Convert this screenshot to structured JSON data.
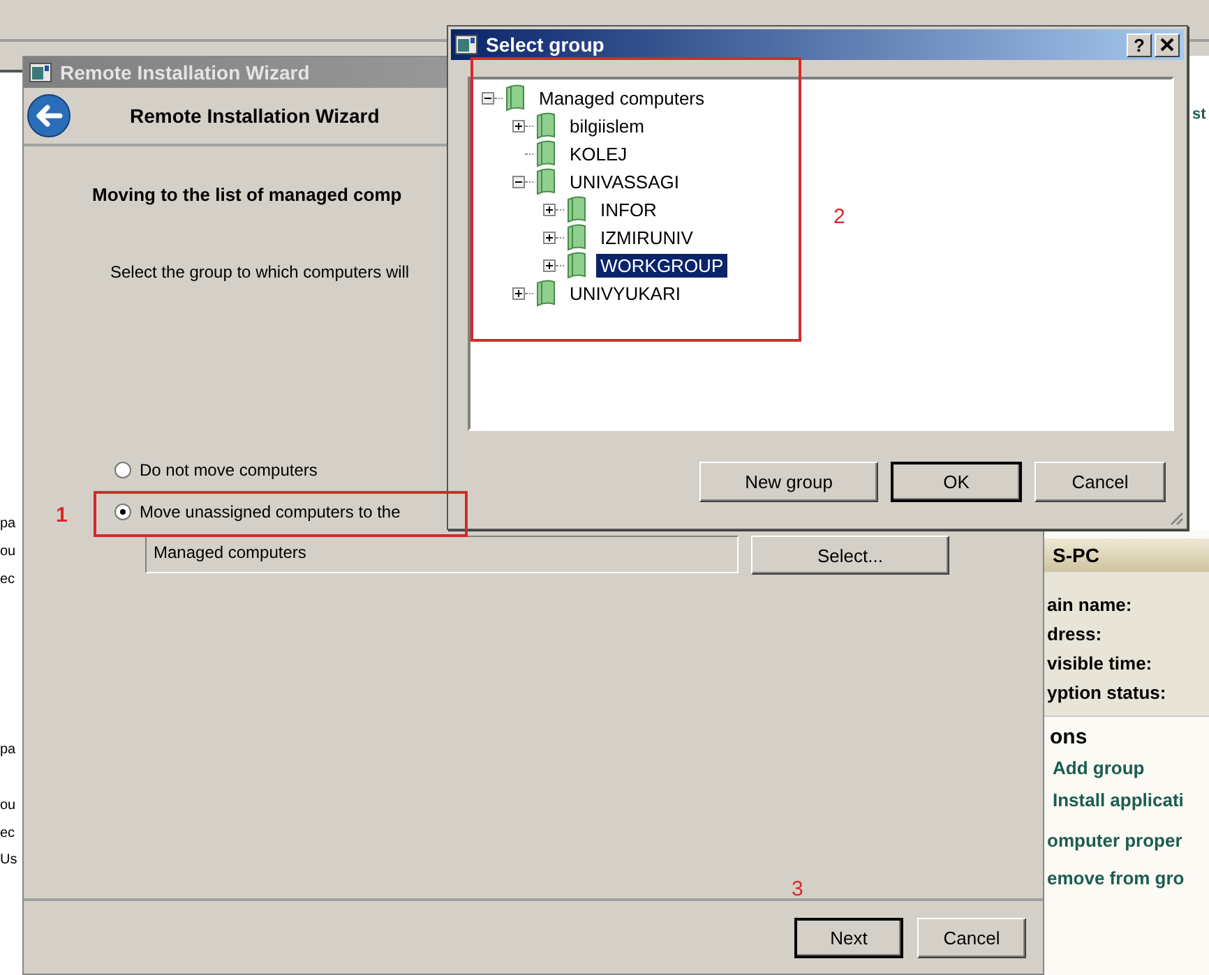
{
  "background": {
    "left_fragments": [
      [
        "pa",
        "ou",
        "ec"
      ],
      [
        "pa"
      ],
      [
        "ou",
        "ec",
        "Us"
      ]
    ],
    "right_fragment": "st",
    "details_panel": {
      "header": "S-PC",
      "fields": [
        "ain name:",
        "dress:",
        "visible time:",
        "yption status:"
      ],
      "section": "ons",
      "links": [
        "Add group",
        "Install applicati",
        "omputer proper",
        "emove from gro"
      ]
    }
  },
  "wizard": {
    "title": "Remote Installation Wizard",
    "header": "Remote Installation Wizard",
    "heading": "Moving to the list of managed comp",
    "description": "Select the group to which computers will",
    "options": [
      {
        "label": "Do not move computers",
        "selected": false
      },
      {
        "label": "Move unassigned computers to the",
        "selected": true
      }
    ],
    "group_field": {
      "value": "Managed computers"
    },
    "select_button": "Select...",
    "buttons": [
      "Next",
      "Cancel"
    ]
  },
  "dialog": {
    "title": "Select group",
    "help_button": "?",
    "tree": [
      {
        "label": "Managed computers",
        "expandable": true,
        "expanded": true,
        "selected": false,
        "children": [
          {
            "label": "bilgiislem",
            "expandable": true,
            "expanded": false,
            "selected": false
          },
          {
            "label": "KOLEJ",
            "expandable": false,
            "selected": false
          },
          {
            "label": "UNIVASSAGI",
            "expandable": true,
            "expanded": true,
            "selected": false,
            "children": [
              {
                "label": "INFOR",
                "expandable": true,
                "expanded": false,
                "selected": false
              },
              {
                "label": "IZMIRUNIV",
                "expandable": true,
                "expanded": false,
                "selected": false
              },
              {
                "label": "WORKGROUP",
                "expandable": true,
                "expanded": false,
                "selected": true
              }
            ]
          },
          {
            "label": "UNIVYUKARI",
            "expandable": true,
            "expanded": false,
            "selected": false
          }
        ]
      }
    ],
    "buttons": [
      {
        "label": "New group",
        "default": false
      },
      {
        "label": "OK",
        "default": true
      },
      {
        "label": "Cancel",
        "default": false
      }
    ]
  },
  "annotations": [
    "1",
    "2",
    "3"
  ]
}
